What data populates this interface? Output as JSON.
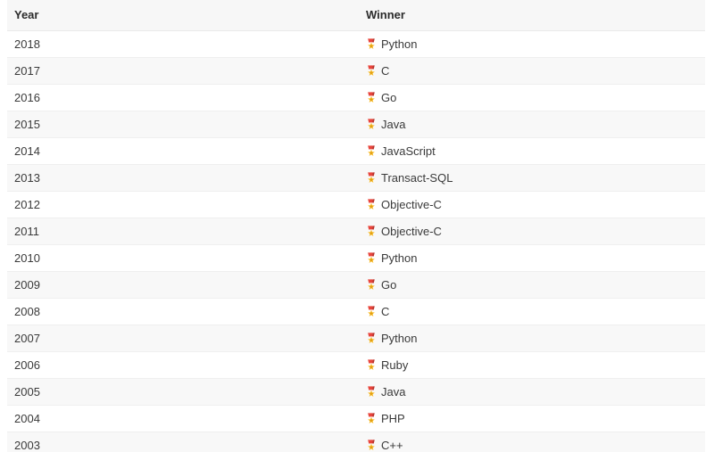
{
  "table": {
    "columns": [
      {
        "key": "year",
        "label": "Year"
      },
      {
        "key": "winner",
        "label": "Winner"
      }
    ],
    "icon_name": "medal-icon",
    "icon_colors": {
      "ribbon": "#e8433a",
      "ribbon_dark": "#b93129",
      "medal": "#fbc02d",
      "medal_dark": "#e2a013"
    },
    "rows": [
      {
        "year": "2018",
        "winner": "Python"
      },
      {
        "year": "2017",
        "winner": "C"
      },
      {
        "year": "2016",
        "winner": "Go"
      },
      {
        "year": "2015",
        "winner": "Java"
      },
      {
        "year": "2014",
        "winner": "JavaScript"
      },
      {
        "year": "2013",
        "winner": "Transact-SQL"
      },
      {
        "year": "2012",
        "winner": "Objective-C"
      },
      {
        "year": "2011",
        "winner": "Objective-C"
      },
      {
        "year": "2010",
        "winner": "Python"
      },
      {
        "year": "2009",
        "winner": "Go"
      },
      {
        "year": "2008",
        "winner": "C"
      },
      {
        "year": "2007",
        "winner": "Python"
      },
      {
        "year": "2006",
        "winner": "Ruby"
      },
      {
        "year": "2005",
        "winner": "Java"
      },
      {
        "year": "2004",
        "winner": "PHP"
      },
      {
        "year": "2003",
        "winner": "C++"
      }
    ]
  },
  "theme": {
    "header_bg": "#f7f7f7",
    "row_alt_bg": "#f8f8f8",
    "row_bg": "#ffffff",
    "border": "#efefef",
    "text": "#3a3a3a",
    "header_text": "#2b2b2b"
  }
}
